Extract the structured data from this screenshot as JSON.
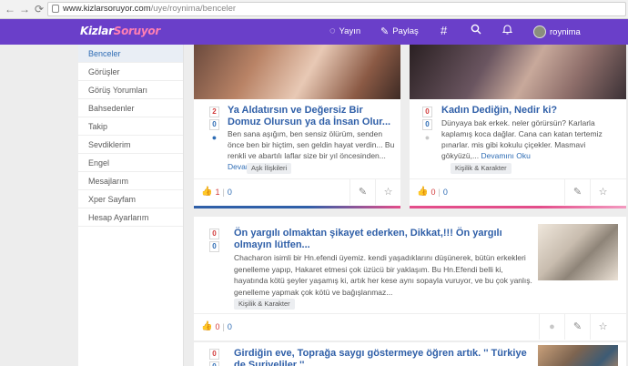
{
  "browser": {
    "url_domain": "www.kizlarsoruyor.com",
    "url_path": "/uye/roynima/benceler",
    "back": "←",
    "forward": "→",
    "reload": "⟳"
  },
  "header": {
    "logo_part1": "Kizlar",
    "logo_part2": "Soruyor",
    "yayin": "Yayın",
    "paylas": "Paylaş",
    "hash": "#",
    "username": "roynima",
    "brand_color": "#6a3fc9"
  },
  "sidebar": {
    "items": [
      {
        "label": "Benceler"
      },
      {
        "label": "Görüşler"
      },
      {
        "label": "Görüş Yorumları"
      },
      {
        "label": "Bahsedenler"
      },
      {
        "label": "Takip"
      },
      {
        "label": "Sevdiklerim"
      },
      {
        "label": "Engel"
      },
      {
        "label": "Mesajlarım"
      },
      {
        "label": "Xper Sayfam"
      },
      {
        "label": "Hesap Ayarlarım"
      }
    ]
  },
  "cards": [
    {
      "vote_up": "2",
      "vote_down": "0",
      "title": "Ya Aldatırsın ve Değersiz Bir Domuz Olursun ya da İnsan Olur...",
      "excerpt": "Ben sana aşığım, ben sensiz ölürüm, senden önce ben bir hiçtim, sen geldin hayat verdin... Bu renkli ve abartılı laflar size bir yıl öncesinden...",
      "more": "Devamını Oku",
      "tag": "Aşk İlişkileri",
      "likes": "1",
      "comments": "0"
    },
    {
      "vote_up": "0",
      "vote_down": "0",
      "title": "Kadın Dediğin, Nedir ki?",
      "excerpt": "Dünyaya bak erkek. neler görürsün? Karlarla kaplamış koca dağlar. Cana can katan tertemiz pınarlar. mis gibi kokulu çiçekler. Masmavi gökyüzü,...",
      "more": "Devamını Oku",
      "tag": "Kişilik & Karakter",
      "likes": "0",
      "comments": "0"
    },
    {
      "vote_up": "0",
      "vote_down": "0",
      "title": "Ön yargılı olmaktan şikayet ederken, Dikkat,!!! Ön yargılı olmayın lütfen...",
      "excerpt": "Chacharon isimli bir Hn.efendi üyemiz. kendi yaşadıklarını düşünerek, bütün erkekleri genelleme yapıp, Hakaret etmesi çok üzücü bir yaklaşım. Bu Hn.Efendi belli ki, hayatında kötü şeyler yaşamış ki, artık her kese aynı sopayla vuruyor, ve bu çok yanlış. genelleme yapmak çok kötü ve bağışlanmaz...",
      "tag": "Kişilik & Karakter",
      "likes": "0",
      "comments": "0"
    },
    {
      "vote_up": "0",
      "vote_down": "0",
      "title": "Girdiğin eve, Toprağa saygı göstermeye öğren artık. '' Türkiye de Suriyeliler ''"
    }
  ]
}
